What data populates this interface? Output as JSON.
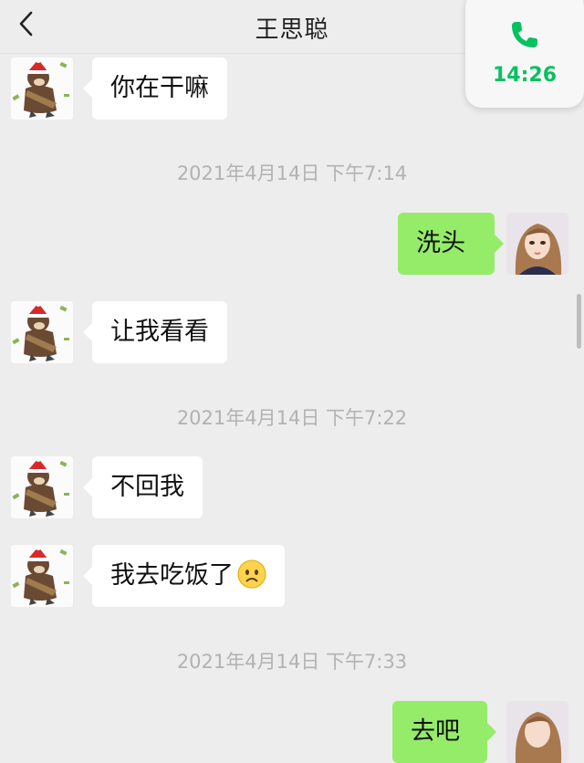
{
  "header": {
    "title": "王思聪",
    "back_icon": "chevron-left-icon"
  },
  "call_float": {
    "icon": "phone-icon",
    "time": "14:26",
    "accent_color": "#07c160"
  },
  "messages": [
    {
      "side": "left",
      "text": "你在干嘛"
    },
    {
      "timestamp": "2021年4月14日 下午7:14"
    },
    {
      "side": "right",
      "text": "洗头"
    },
    {
      "side": "left",
      "text": "让我看看"
    },
    {
      "timestamp": "2021年4月14日 下午7:22"
    },
    {
      "side": "left",
      "text": "不回我"
    },
    {
      "side": "left",
      "text": "我去吃饭了",
      "emoji": "frowning-face-icon"
    },
    {
      "timestamp": "2021年4月14日 下午7:33"
    },
    {
      "side": "right",
      "text": "去吧"
    }
  ],
  "colors": {
    "background": "#ededed",
    "outgoing_bubble": "#95ec69",
    "incoming_bubble": "#ffffff",
    "timestamp_text": "#b2b2b2"
  }
}
